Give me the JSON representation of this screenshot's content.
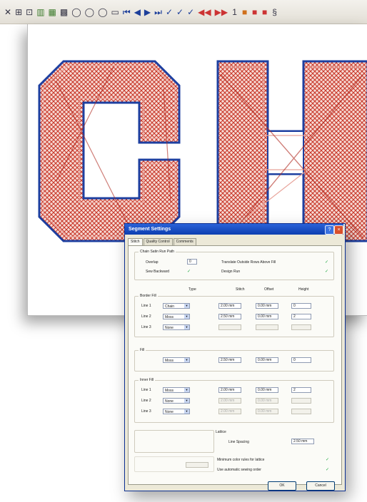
{
  "toolbar": {
    "icons": [
      "close-x",
      "grid",
      "zoom",
      "hatch",
      "fill",
      "fill2",
      "circle-1",
      "circle-2",
      "circle-3",
      "text-3d",
      "step-first",
      "step-back",
      "step-forward",
      "step-last",
      "stitch-1",
      "stitch-2",
      "stitch-3",
      "stitch-red-1",
      "stitch-red-2",
      "number-tool",
      "color-orange",
      "color-red",
      "color-red-2",
      "tool-last"
    ],
    "glyphs": [
      "✕",
      "⊞",
      "⊡",
      "▥",
      "▦",
      "▩",
      "◯",
      "◯",
      "◯",
      "▭",
      "⏮",
      "◀",
      "▶",
      "⏭",
      "✓",
      "✓",
      "✓",
      "◀◀",
      "▶▶",
      "1",
      "■",
      "■",
      "■",
      "§"
    ]
  },
  "canvas": {
    "letters": [
      "C",
      "H"
    ],
    "fill_color": "#c8382a",
    "outline_color": "#1d3fa0"
  },
  "dialog": {
    "title": "Segment Settings",
    "tabs": [
      "Stitch",
      "Quality Control",
      "Comments"
    ],
    "chain_group": "Chain Satin Run Path",
    "overlap_label": "Overlap",
    "overlap_value": "0",
    "sew_backward_label": "Sew Backward",
    "sew_backward_checked": true,
    "translate_label": "Translate Outside Rows Above Fill",
    "translate_checked": true,
    "design_run_label": "Design Run",
    "design_run_checked": true,
    "col_type": "Type",
    "col_stitch": "Stitch",
    "col_offset": "Offset",
    "col_height": "Height",
    "border_fill_group": "Border Fill",
    "border_rows": [
      {
        "label": "Line 1",
        "type": "Chain",
        "stitch": "2.00 mm",
        "offset": "0.00 mm",
        "height": "0",
        "disabled": false
      },
      {
        "label": "Line 2",
        "type": "Moss",
        "stitch": "2.50 mm",
        "offset": "0.00 mm",
        "height": "2",
        "disabled": false
      },
      {
        "label": "Line 3",
        "type": "None",
        "stitch": "",
        "offset": "",
        "height": "",
        "disabled": true
      }
    ],
    "fill_group": "Fill",
    "fill_row": {
      "type": "Moss",
      "stitch": "2.50 mm",
      "offset": "0.00 mm",
      "height": "0"
    },
    "inner_fill_group": "Inner Fill",
    "inner_rows": [
      {
        "label": "Line 1",
        "type": "Moss",
        "stitch": "2.00 mm",
        "offset": "0.00 mm",
        "height": "2",
        "disabled": false
      },
      {
        "label": "Line 2",
        "type": "None",
        "stitch": "2.00 mm",
        "offset": "0.00 mm",
        "height": "",
        "disabled": true
      },
      {
        "label": "Line 3",
        "type": "None",
        "stitch": "2.00 mm",
        "offset": "0.00 mm",
        "height": "",
        "disabled": true
      }
    ],
    "lattice_group": "Lattice",
    "line_spacing_label": "Line Spacing",
    "line_spacing_value": "2.50 mm",
    "lattice_auto_label": "Minimum color rules for lattice",
    "lattice_auto_checked": true,
    "auto_sewing_label": "Use automatic sewing order",
    "auto_sewing_checked": true,
    "ok_label": "OK",
    "cancel_label": "Cancel",
    "help_glyph": "?",
    "close_glyph": "×",
    "arrow_glyph": "▼",
    "check_glyph": "✓"
  }
}
